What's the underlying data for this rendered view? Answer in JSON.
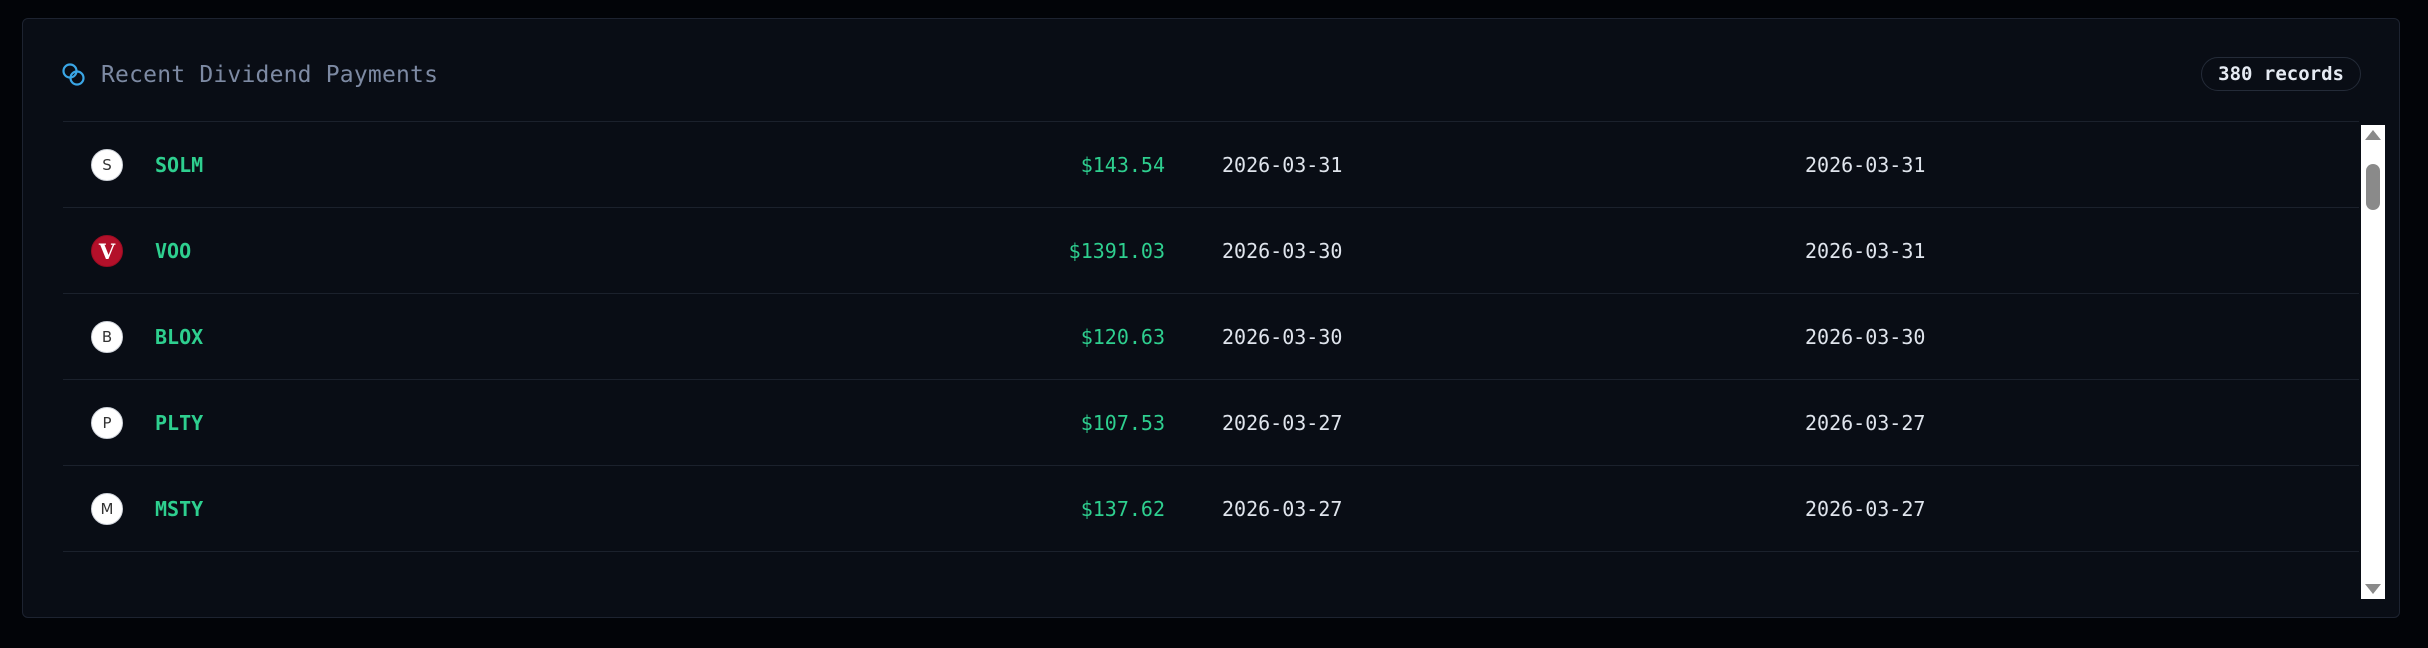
{
  "panel": {
    "title": "Recent Dividend Payments",
    "records_badge": "380 records",
    "title_icon": "coins-icon"
  },
  "colors": {
    "accent": "#2ecf8f",
    "title_icon": "#3aa6e6",
    "brand_logo": "#b3102a"
  },
  "rows": [
    {
      "logo_letter": "S",
      "logo_style": "plain",
      "ticker": "SOLM",
      "amount": "$143.54",
      "date_a": "2026-03-31",
      "date_b": "2026-03-31"
    },
    {
      "logo_letter": "V",
      "logo_style": "brand",
      "ticker": "VOO",
      "amount": "$1391.03",
      "date_a": "2026-03-30",
      "date_b": "2026-03-31"
    },
    {
      "logo_letter": "B",
      "logo_style": "plain",
      "ticker": "BLOX",
      "amount": "$120.63",
      "date_a": "2026-03-30",
      "date_b": "2026-03-30"
    },
    {
      "logo_letter": "P",
      "logo_style": "plain",
      "ticker": "PLTY",
      "amount": "$107.53",
      "date_a": "2026-03-27",
      "date_b": "2026-03-27"
    },
    {
      "logo_letter": "M",
      "logo_style": "plain",
      "ticker": "MSTY",
      "amount": "$137.62",
      "date_a": "2026-03-27",
      "date_b": "2026-03-27"
    }
  ],
  "scrollbar": {
    "position_fraction": 0.04
  }
}
